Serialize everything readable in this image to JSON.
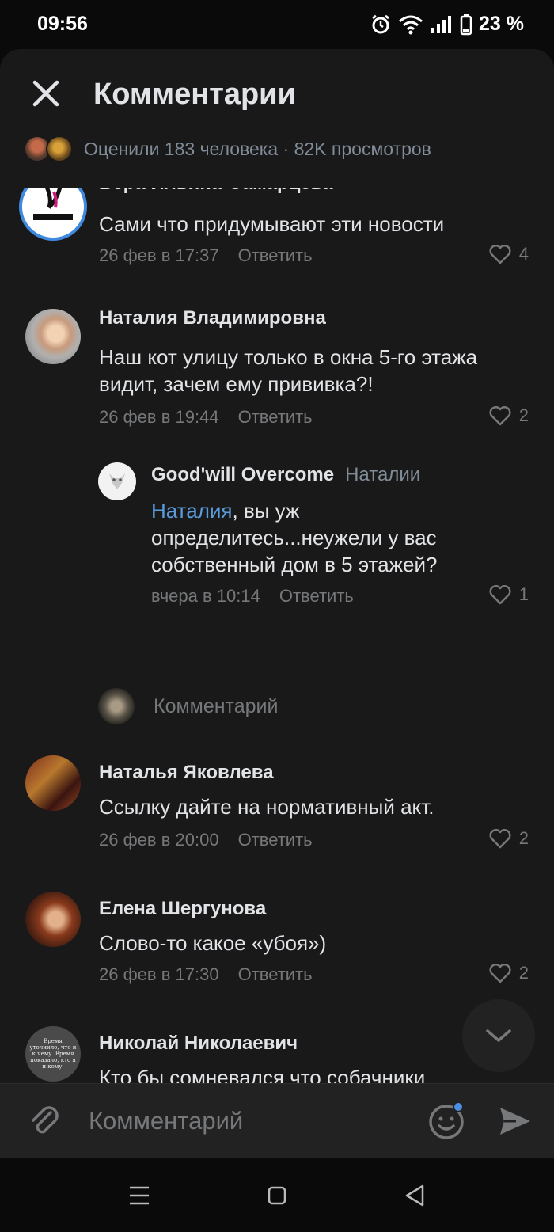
{
  "status": {
    "time": "09:56",
    "battery": "23 %"
  },
  "header": {
    "title": "Комментарии"
  },
  "likes": {
    "text": "Оценили 183 человека · 82K просмотров"
  },
  "comments": [
    {
      "author": "Вера Ильина-Самарцева",
      "text": "Сами что придумывают эти новости",
      "date": "26 фев в 17:37",
      "reply": "Ответить",
      "likes": "4",
      "avatar_text": "VERSA STYLE"
    },
    {
      "author": "Наталия Владимировна",
      "text": "Наш кот улицу только в окна 5-го этажа видит, зачем ему прививка?!",
      "date": "26 фев в 19:44",
      "reply": "Ответить",
      "likes": "2"
    },
    {
      "author": "Good'will Overcome",
      "reply_to": "Наталии",
      "mention": "Наталия",
      "text": ", вы уж определитесь...неужели у вас собственный дом в 5 этажей?",
      "date": "вчера в 10:14",
      "reply": "Ответить",
      "likes": "1"
    },
    {
      "author": "Наталья Яковлева",
      "text": "Ссылку дайте на нормативный акт.",
      "date": "26 фев в 20:00",
      "reply": "Ответить",
      "likes": "2"
    },
    {
      "author": "Елена Шергунова",
      "text": "Слово-то какое «убоя»)",
      "date": "26 фев в 17:30",
      "reply": "Ответить",
      "likes": "2"
    },
    {
      "author": "Николай Николаевич",
      "text": "Кто бы сомневался что собачники зависимые начнут в комментах волком выть. По мимо ликвидации",
      "avatar_text": "Время уточнило, что и к чему. Время показало, кто я и кому."
    }
  ],
  "reply_prompt": {
    "placeholder": "Комментарий"
  },
  "composer": {
    "placeholder": "Комментарий"
  },
  "colors": {
    "background": "#191919",
    "accent": "#5a9bdb",
    "secondary_text": "#76787a"
  }
}
